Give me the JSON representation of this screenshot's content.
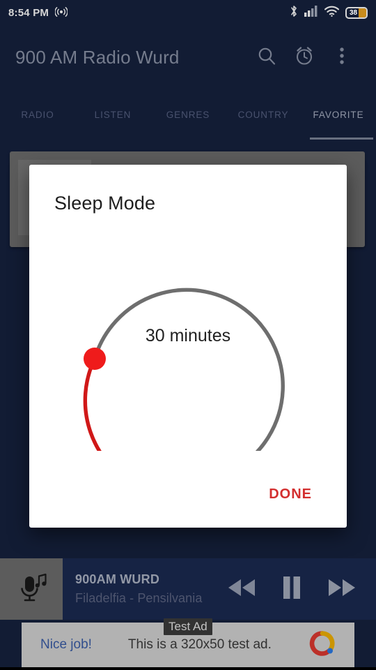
{
  "statusbar": {
    "time": "8:54 PM",
    "cast_icon": "broadcast-icon",
    "bluetooth_icon": "bluetooth-icon",
    "signal_icon": "cellular-signal-icon",
    "wifi_icon": "wifi-icon",
    "battery_icon": "battery-icon",
    "battery_level": "38"
  },
  "appbar": {
    "title": "900 AM Radio Wurd",
    "search_icon": "search-icon",
    "alarm_icon": "alarm-clock-icon",
    "overflow_icon": "more-vertical-icon"
  },
  "tabs": [
    {
      "label": "RADIO",
      "active": false
    },
    {
      "label": "LISTEN",
      "active": false
    },
    {
      "label": "GENRES",
      "active": false
    },
    {
      "label": "COUNTRY",
      "active": false
    },
    {
      "label": "FAVORITE",
      "active": true
    }
  ],
  "dialog": {
    "title": "Sleep Mode",
    "value_label": "30 minutes",
    "done_label": "DONE",
    "slider": {
      "minutes": 30,
      "thumb_color": "#ef1b1b",
      "progress_color": "#d01818",
      "track_color": "#6e6e6e"
    }
  },
  "player": {
    "thumb_icon": "microphone-music-icon",
    "station": "900AM WURD",
    "location": "Filadelfia - Pensilvania",
    "rewind_icon": "rewind-icon",
    "pause_icon": "pause-icon",
    "forward_icon": "fast-forward-icon"
  },
  "ad": {
    "badge": "Test Ad",
    "cta": "Nice job!",
    "body": "This is a 320x50 test ad.",
    "logo_icon": "admob-logo-icon"
  },
  "colors": {
    "background": "#16223f",
    "appbar": "#16223f",
    "accent_red": "#d32f2f",
    "card_gray": "#6e6e6e"
  }
}
